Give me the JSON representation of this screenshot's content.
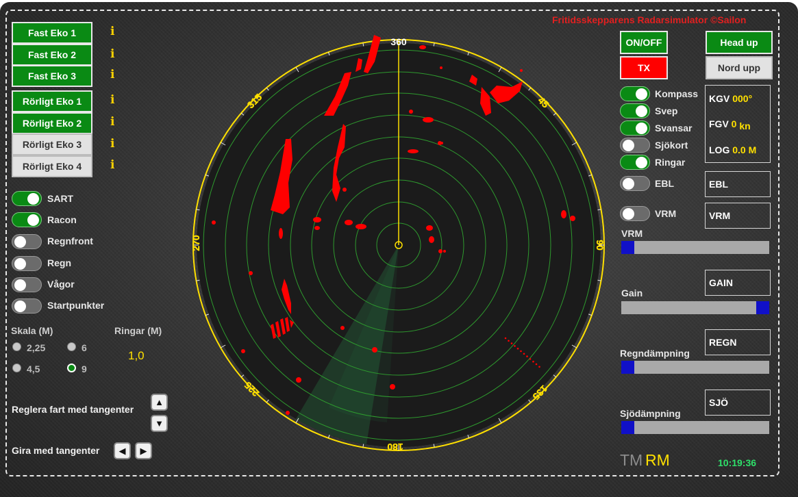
{
  "title": "Fritidsskepparens Radarsimulator ©Sailon",
  "echo_buttons": [
    {
      "label": "Fast Eko 1",
      "active": true
    },
    {
      "label": "Fast Eko 2",
      "active": true
    },
    {
      "label": "Fast Eko 3",
      "active": true
    },
    {
      "label": "Rörligt Eko 1",
      "active": true
    },
    {
      "label": "Rörligt Eko 2",
      "active": true
    },
    {
      "label": "Rörligt Eko 3",
      "active": false
    },
    {
      "label": "Rörligt Eko 4",
      "active": false
    }
  ],
  "info_glyph": "i",
  "left_toggles": [
    {
      "label": "SART",
      "on": true
    },
    {
      "label": "Racon",
      "on": true
    },
    {
      "label": "Regnfront",
      "on": false
    },
    {
      "label": "Regn",
      "on": false
    },
    {
      "label": "Vågor",
      "on": false
    },
    {
      "label": "Startpunkter",
      "on": false
    }
  ],
  "scale": {
    "label": "Skala (M)",
    "options": [
      {
        "label": "2,25",
        "selected": false
      },
      {
        "label": "6",
        "selected": false
      },
      {
        "label": "4,5",
        "selected": false
      },
      {
        "label": "9",
        "selected": true
      }
    ]
  },
  "rings": {
    "label": "Ringar (M)",
    "value": "1,0"
  },
  "speed_control": {
    "label": "Reglera fart med tangenter",
    "up": "▲",
    "down": "▼"
  },
  "turn_control": {
    "label": "Gira med tangenter",
    "left": "◀",
    "right": "▶"
  },
  "radar": {
    "bearing_labels": [
      "360",
      "45",
      "90",
      "135",
      "180",
      "225",
      "270",
      "315"
    ],
    "heading_deg": 0,
    "sweep_deg": 212
  },
  "controls": {
    "onoff": "ON/OFF",
    "tx": "TX",
    "head_up": "Head up",
    "nord_upp": "Nord upp"
  },
  "right_toggles": [
    {
      "label": "Kompass",
      "on": true
    },
    {
      "label": "Svep",
      "on": true
    },
    {
      "label": "Svansar",
      "on": true
    },
    {
      "label": "Sjökort",
      "on": false
    },
    {
      "label": "Ringar",
      "on": true
    },
    {
      "label": "EBL",
      "on": false
    },
    {
      "label": "VRM",
      "on": false
    }
  ],
  "readouts": {
    "kgv_label": "KGV",
    "kgv_value": "000°",
    "fgv_label": "FGV",
    "fgv_value": "0",
    "fgv_unit": "kn",
    "log_label": "LOG",
    "log_value": "0.0 M",
    "ebl": "EBL",
    "vrm": "VRM"
  },
  "sliders": [
    {
      "label": "VRM",
      "box": "",
      "value": 0.0
    },
    {
      "label": "Gain",
      "box": "GAIN",
      "value": 1.0
    },
    {
      "label": "Regndämpning",
      "box": "REGN",
      "value": 0.0
    },
    {
      "label": "Sjödämpning",
      "box": "SJÖ",
      "value": 0.0
    }
  ],
  "mode": {
    "tm": "TM",
    "rm": "RM"
  },
  "clock": "10:19:36",
  "colors": {
    "green": "#0a8a14",
    "red": "#ff0000",
    "yellow": "#ffe000",
    "echo": "#ff0000",
    "ring": "#2e9a2e",
    "clock": "#2ee06a",
    "slider_thumb": "#1010c8"
  }
}
